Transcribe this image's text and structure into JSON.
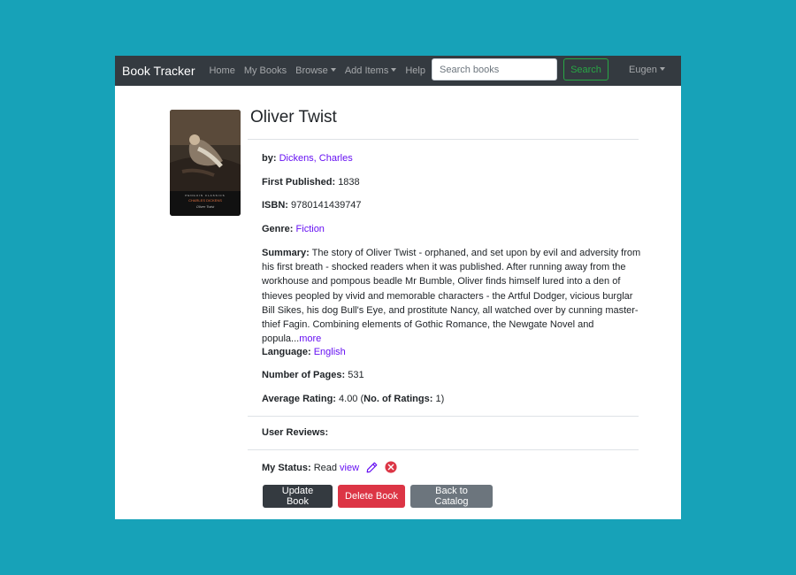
{
  "nav": {
    "brand": "Book Tracker",
    "links": [
      "Home",
      "My Books",
      "Browse",
      "Add Items",
      "Help"
    ],
    "search_placeholder": "Search books",
    "search_button": "Search",
    "user": "Eugen"
  },
  "book": {
    "title": "Oliver Twist",
    "by_label": "by:",
    "author": "Dickens, Charles",
    "first_published_label": "First Published:",
    "first_published": "1838",
    "isbn_label": "ISBN:",
    "isbn": "9780141439747",
    "genre_label": "Genre:",
    "genre": "Fiction",
    "summary_label": "Summary:",
    "summary": "The story of Oliver Twist - orphaned, and set upon by evil and adversity from his first breath - shocked readers when it was published. After running away from the workhouse and pompous beadle Mr Bumble, Oliver finds himself lured into a den of thieves peopled by vivid and memorable characters - the Artful Dodger, vicious burglar Bill Sikes, his dog Bull's Eye, and prostitute Nancy, all watched over by cunning master-thief Fagin. Combining elements of Gothic Romance, the Newgate Novel and popula...",
    "more_link": "more",
    "language_label": "Language:",
    "language": "English",
    "pages_label": "Number of Pages:",
    "pages": "531",
    "rating_label": "Average Rating:",
    "rating": "4.00",
    "ratings_count_label": "No. of Ratings:",
    "ratings_count": "1",
    "reviews_label": "User Reviews:",
    "status_label": "My Status:",
    "status": "Read",
    "view_link": "view"
  },
  "cover": {
    "publisher_line": "PENGUIN CLASSICS",
    "cover_title": "CHARLES DICKENS",
    "cover_subtitle": "Oliver Twist"
  },
  "actions": {
    "update": "Update Book",
    "delete": "Delete Book",
    "back": "Back to Catalog"
  },
  "colors": {
    "background": "#17a2b8",
    "navbar": "#343a40",
    "link": "#6610f2",
    "danger": "#dc3545",
    "dark": "#343a40",
    "secondary": "#6c757d",
    "success": "#28a745"
  }
}
